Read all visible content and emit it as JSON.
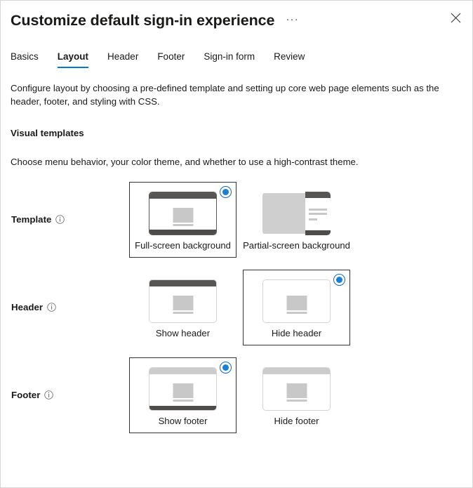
{
  "dialog": {
    "title": "Customize default sign-in experience",
    "more_label": "···",
    "close_label": "Close"
  },
  "tabs": [
    {
      "label": "Basics",
      "active": false
    },
    {
      "label": "Layout",
      "active": true
    },
    {
      "label": "Header",
      "active": false
    },
    {
      "label": "Footer",
      "active": false
    },
    {
      "label": "Sign-in form",
      "active": false
    },
    {
      "label": "Review",
      "active": false
    }
  ],
  "body": {
    "description": "Configure layout by choosing a pre-defined template and setting up core web page elements such as the header, footer, and styling with CSS.",
    "section_title": "Visual templates",
    "section_description": "Choose menu behavior, your color theme, and whether to use a high-contrast theme."
  },
  "rows": {
    "template": {
      "label": "Template",
      "info": "info-icon",
      "options": [
        {
          "label": "Full-screen background",
          "selected": true
        },
        {
          "label": "Partial-screen background",
          "selected": false
        }
      ]
    },
    "header": {
      "label": "Header",
      "info": "info-icon",
      "options": [
        {
          "label": "Show header",
          "selected": false
        },
        {
          "label": "Hide header",
          "selected": true
        }
      ]
    },
    "footer": {
      "label": "Footer",
      "info": "info-icon",
      "options": [
        {
          "label": "Show footer",
          "selected": true
        },
        {
          "label": "Hide footer",
          "selected": false
        }
      ]
    }
  },
  "colors": {
    "accent": "#0078d4",
    "radio": "#1b7fd4",
    "selected_border": "#333333",
    "thumb_dark": "#585654",
    "thumb_light": "#cccccc",
    "thumb_content": "#c8c8c8"
  }
}
